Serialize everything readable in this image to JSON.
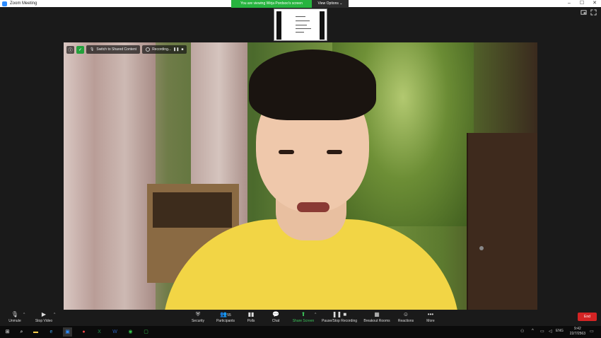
{
  "window": {
    "title": "Zoom Meeting",
    "controls": [
      "–",
      "☐",
      "✕"
    ]
  },
  "banner": {
    "message": "You are viewing Wirja Pordsoo's screen",
    "view_options": "View Options ⌄"
  },
  "video_overlay": {
    "switch_label": "Switch to Shared Content",
    "recording_label": "Recording..."
  },
  "toolbar": {
    "unmute": "Unmute",
    "stop_video": "Stop Video",
    "security": "Security",
    "participants": "Participants",
    "participants_count": "55",
    "polls": "Polls",
    "chat": "Chat",
    "share_screen": "Share Screen",
    "pause_stop_recording": "Pause/Stop Recording",
    "breakout_rooms": "Breakout Rooms",
    "reactions": "Reactions",
    "more": "More",
    "end": "End"
  },
  "taskbar": {
    "time": "9:42",
    "date": "22/7/2563",
    "lang": "ENG"
  },
  "colors": {
    "banner_green": "#27b43f",
    "end_red": "#d42424",
    "share_green": "#3bc35a",
    "shirt_yellow": "#f2d545"
  }
}
